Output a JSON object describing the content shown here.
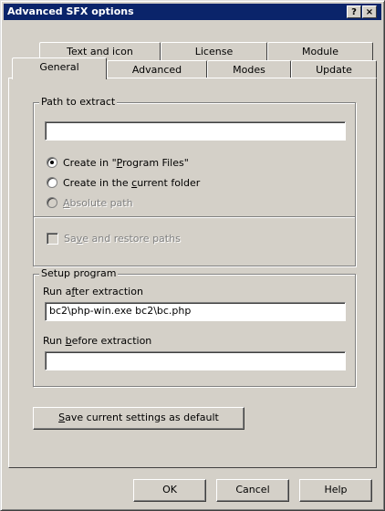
{
  "window": {
    "title": "Advanced SFX options",
    "help_label": "?",
    "close_label": "×"
  },
  "tabs": {
    "row1": [
      "Text and icon",
      "License",
      "Module"
    ],
    "row2": [
      "General",
      "Advanced",
      "Modes",
      "Update"
    ],
    "active": "General"
  },
  "path_group": {
    "label": "Path to extract",
    "path_value": "",
    "options": [
      {
        "pre": "Create in \"",
        "ul": "P",
        "post": "rogram Files\"",
        "checked": true,
        "disabled": false
      },
      {
        "pre": "Create in the ",
        "ul": "c",
        "post": "urrent folder",
        "checked": false,
        "disabled": false
      },
      {
        "pre": "",
        "ul": "A",
        "post": "bsolute path",
        "checked": false,
        "disabled": true
      }
    ],
    "save_restore": {
      "pre": "Sa",
      "ul": "v",
      "post": "e and restore paths",
      "disabled": true
    }
  },
  "setup_group": {
    "label": "Setup program",
    "run_after_pre": "Run a",
    "run_after_ul": "f",
    "run_after_post": "ter extraction",
    "run_after_value": "bc2\\php-win.exe bc2\\bc.php",
    "run_before_pre": "Run ",
    "run_before_ul": "b",
    "run_before_post": "efore extraction",
    "run_before_value": ""
  },
  "save_default": {
    "ul": "S",
    "post": "ave current settings as default"
  },
  "footer": {
    "ok": "OK",
    "cancel": "Cancel",
    "help": "Help"
  }
}
